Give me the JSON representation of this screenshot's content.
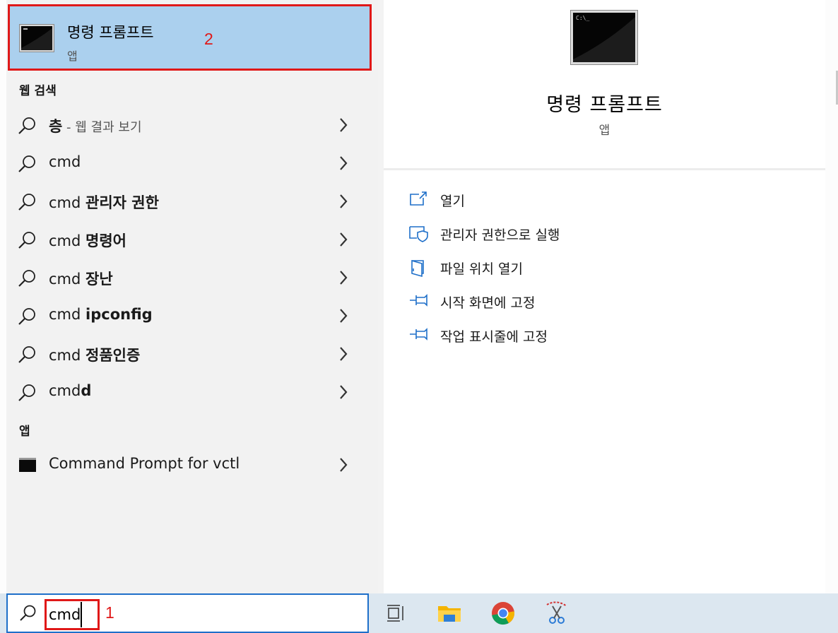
{
  "best_match": {
    "title": "명령 프롬프트",
    "subtitle": "앱",
    "annotation": "2"
  },
  "web_section": {
    "header": "웹 검색",
    "results": [
      {
        "plain": "",
        "bold": "층",
        "hint": " - 웹 결과 보기"
      },
      {
        "plain": "cmd",
        "bold": "",
        "hint": ""
      },
      {
        "plain": "cmd ",
        "bold": "관리자 권한",
        "hint": ""
      },
      {
        "plain": "cmd ",
        "bold": "명령어",
        "hint": ""
      },
      {
        "plain": "cmd ",
        "bold": "장난",
        "hint": ""
      },
      {
        "plain": "cmd ",
        "bold": "ipconfig",
        "hint": ""
      },
      {
        "plain": "cmd ",
        "bold": "정품인증",
        "hint": ""
      },
      {
        "plain": "cmd",
        "bold": "d",
        "hint": ""
      }
    ]
  },
  "apps_section": {
    "header": "앱",
    "items": [
      {
        "label": "Command Prompt for vctl"
      }
    ]
  },
  "preview": {
    "title": "명령 프롬프트",
    "subtitle": "앱",
    "icon_text": "C:\\_",
    "actions": [
      {
        "label": "열기",
        "icon": "open-icon"
      },
      {
        "label": "관리자 권한으로 실행",
        "icon": "shield-admin-icon"
      },
      {
        "label": "파일 위치 열기",
        "icon": "file-location-icon"
      },
      {
        "label": "시작 화면에 고정",
        "icon": "pin-icon"
      },
      {
        "label": "작업 표시줄에 고정",
        "icon": "pin-icon"
      }
    ]
  },
  "taskbar": {
    "search_value": "cmd",
    "annotation": "1",
    "icons": [
      "task-view-icon",
      "file-explorer-icon",
      "chrome-icon",
      "snipping-tool-icon"
    ]
  },
  "colors": {
    "accent": "#1e6fc9",
    "highlight": "#abd0ee",
    "annotation_red": "#e01818"
  }
}
